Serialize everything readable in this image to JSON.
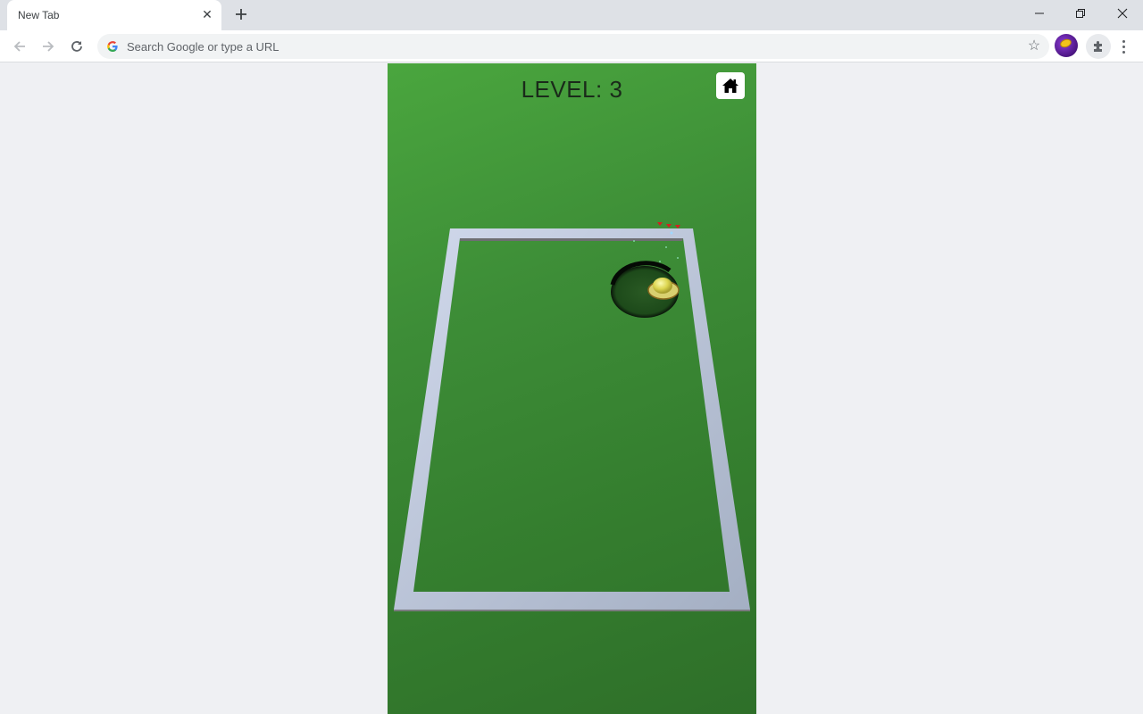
{
  "browser": {
    "tab": {
      "title": "New Tab",
      "close_icon": "close-icon"
    },
    "new_tab_icon": "plus-icon",
    "window_controls": [
      "minimize-icon",
      "restore-icon",
      "close-icon"
    ],
    "nav": {
      "back_icon": "arrow-left-icon",
      "forward_icon": "arrow-right-icon",
      "reload_icon": "reload-icon"
    },
    "omnibox": {
      "placeholder": "Search Google or type a URL",
      "value": ""
    },
    "bookmark_icon": "star-icon",
    "profile_icon": "profile-avatar",
    "extensions_icon": "puzzle-icon",
    "menu_icon": "kebab-menu-icon"
  },
  "game": {
    "level_label": "LEVEL:",
    "level_value": "3",
    "home_icon": "home-icon",
    "colors": {
      "field": "#3d8d37",
      "wall": "#c3cde0",
      "hole": "#0e1a0e",
      "ball": "#e8e07a",
      "particles": "#d42020"
    }
  }
}
